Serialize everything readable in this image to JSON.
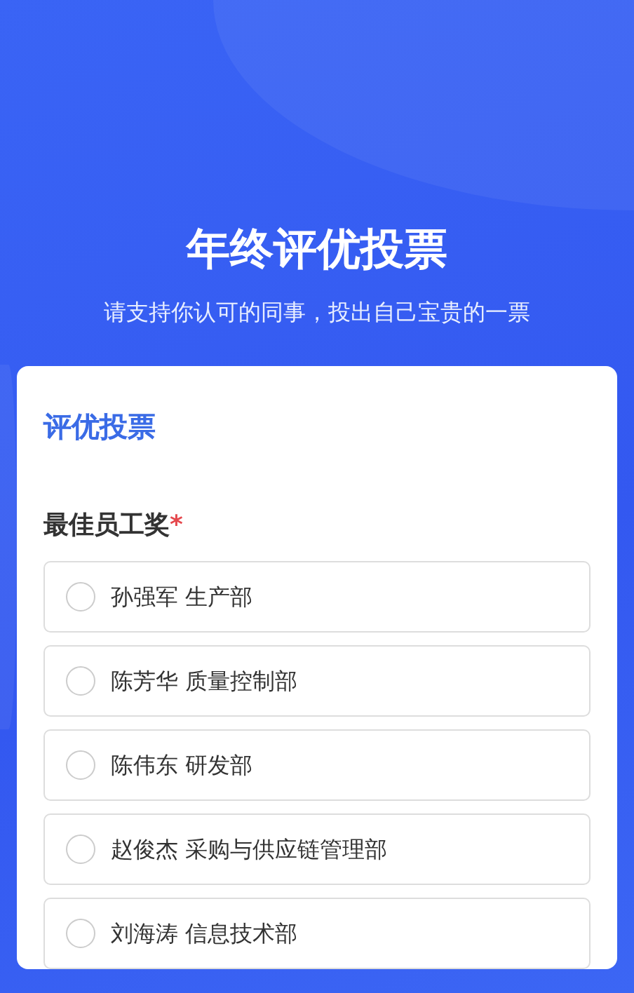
{
  "header": {
    "title": "年终评优投票",
    "subtitle": "请支持你认可的同事，投出自己宝贵的一票"
  },
  "form": {
    "title": "评优投票",
    "question": {
      "label": "最佳员工奖",
      "required": true,
      "required_mark": "*",
      "options": [
        {
          "label": "孙强军 生产部",
          "selected": false
        },
        {
          "label": "陈芳华 质量控制部",
          "selected": false
        },
        {
          "label": "陈伟东 研发部",
          "selected": false
        },
        {
          "label": "赵俊杰 采购与供应链管理部",
          "selected": false
        },
        {
          "label": "刘海涛 信息技术部",
          "selected": false
        }
      ]
    }
  }
}
